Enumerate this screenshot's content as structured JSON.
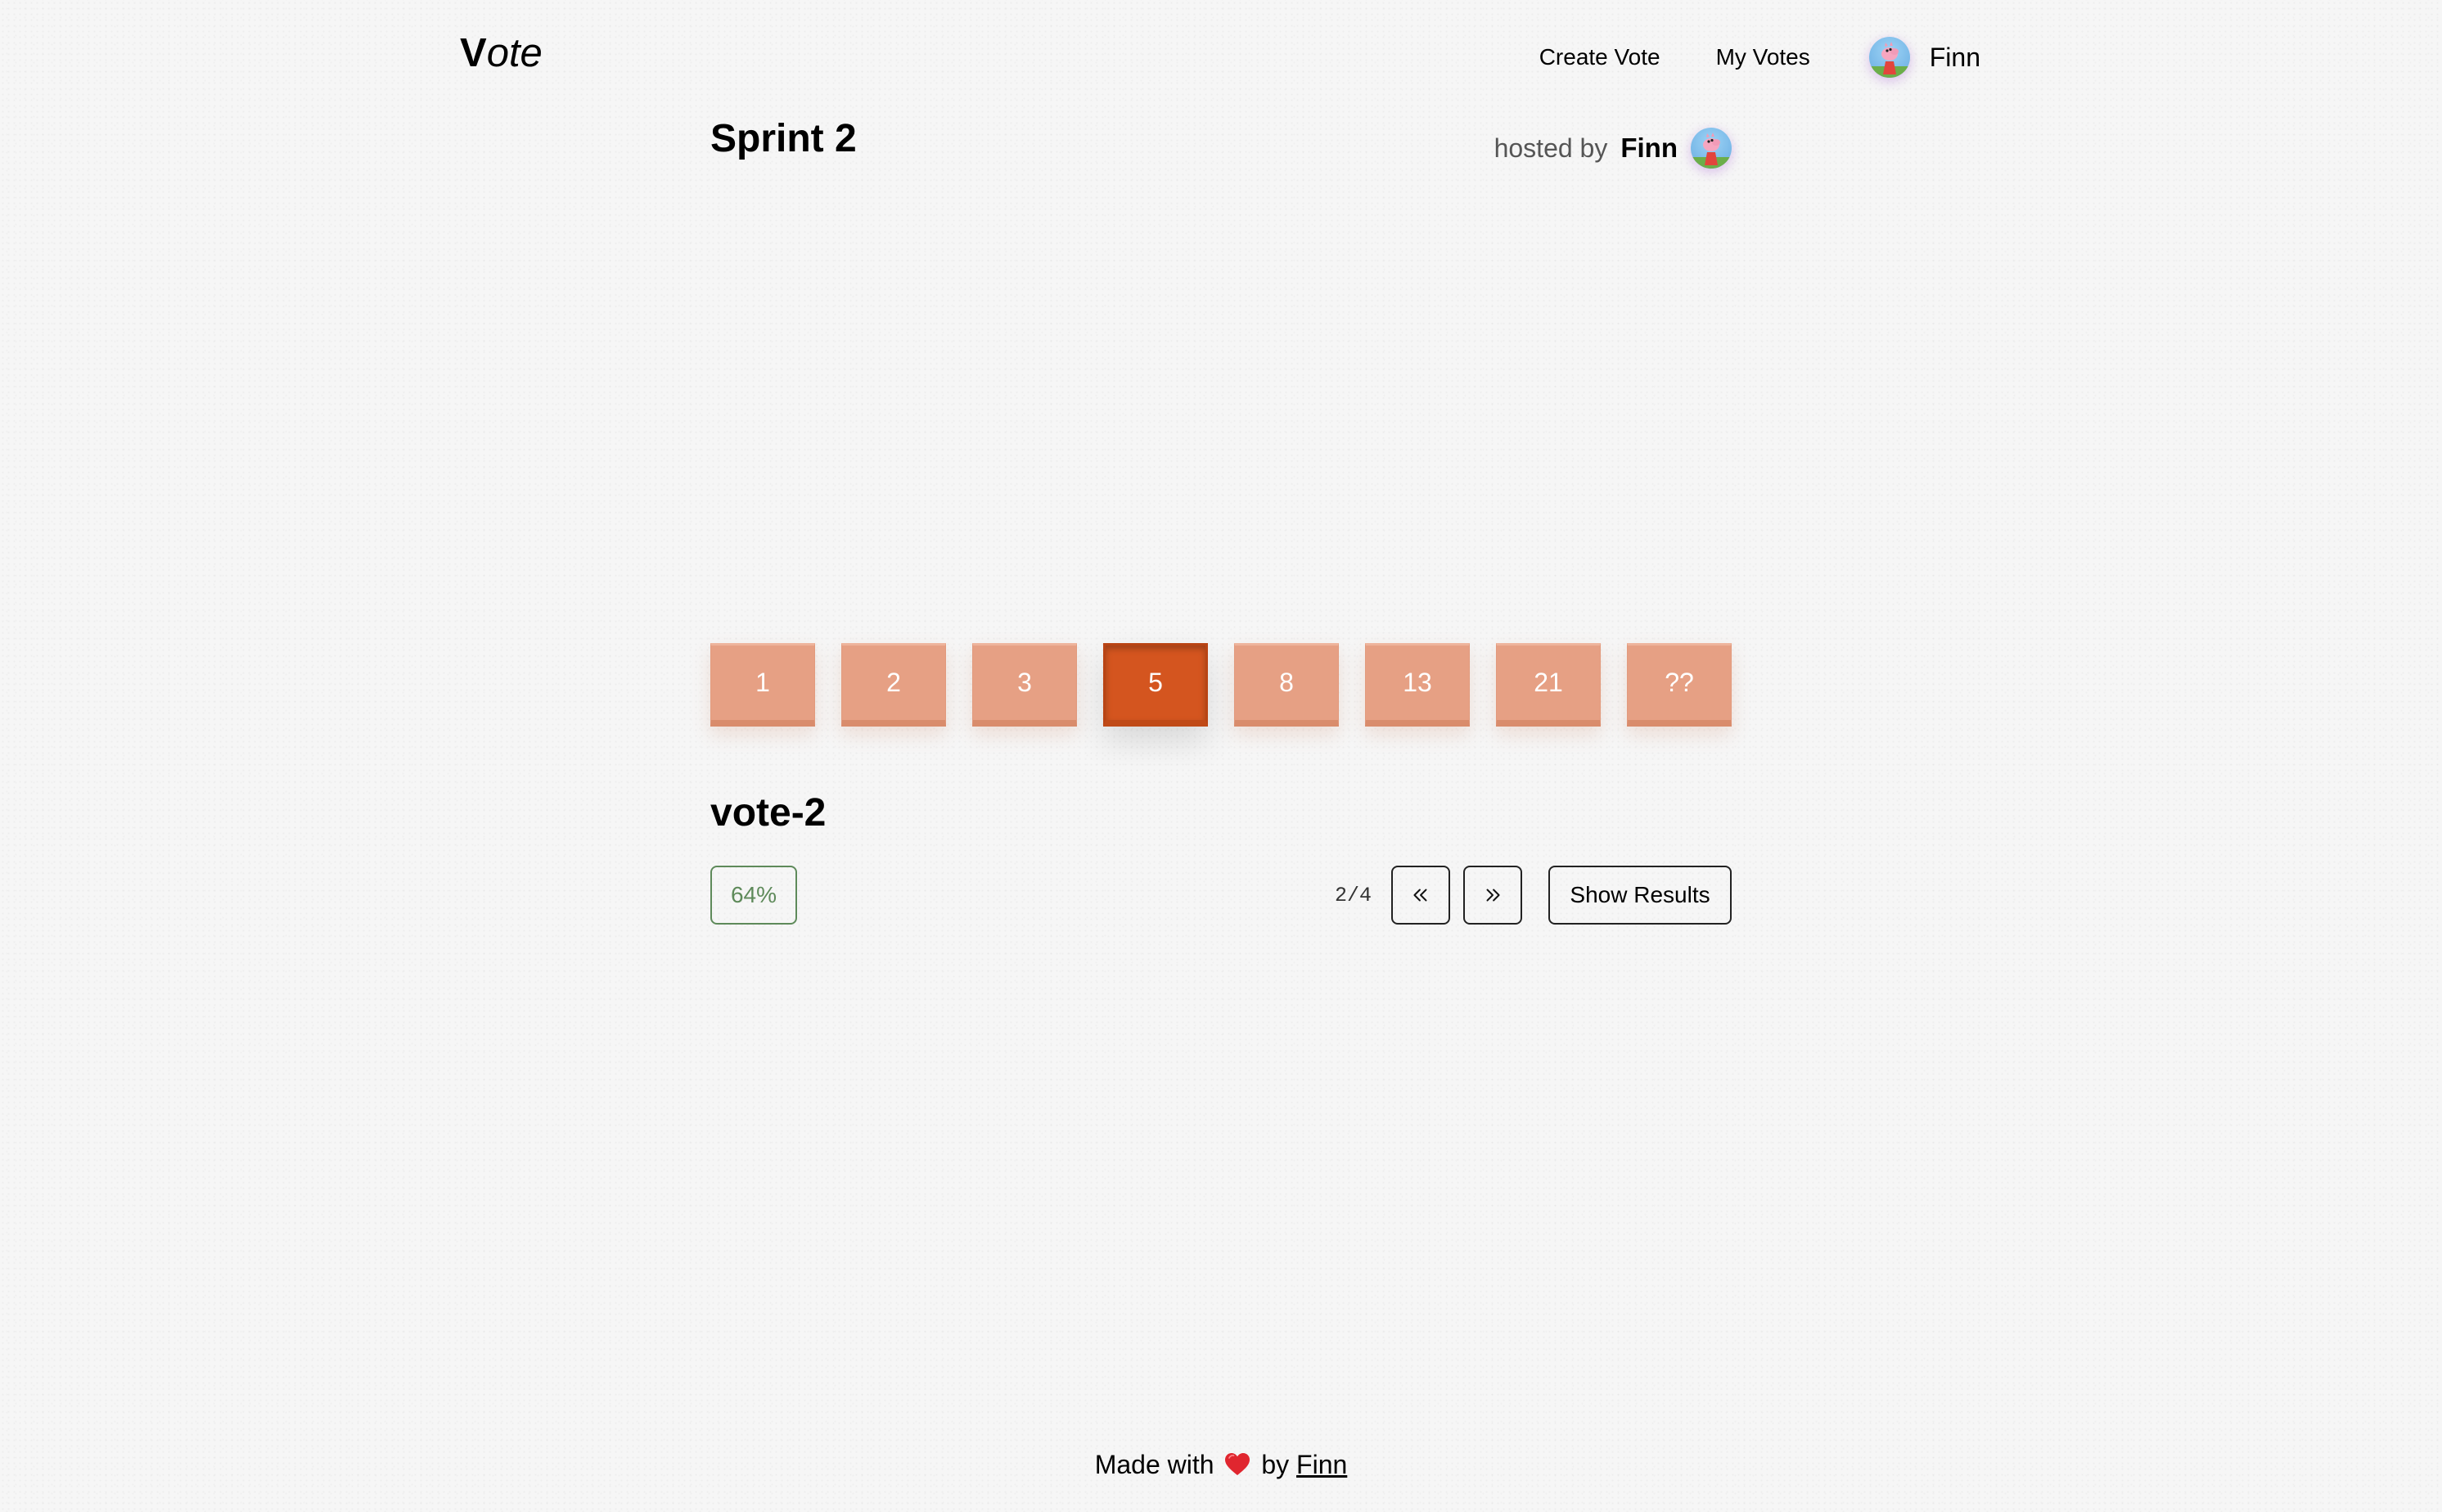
{
  "header": {
    "logo_initial": "V",
    "logo_rest": "ote",
    "nav": {
      "create_vote": "Create Vote",
      "my_votes": "My Votes",
      "user_name": "Finn"
    }
  },
  "session": {
    "title": "Sprint 2",
    "hosted_by_label": "hosted by",
    "host_name": "Finn"
  },
  "cards": [
    {
      "label": "1",
      "selected": false
    },
    {
      "label": "2",
      "selected": false
    },
    {
      "label": "3",
      "selected": false
    },
    {
      "label": "5",
      "selected": true
    },
    {
      "label": "8",
      "selected": false
    },
    {
      "label": "13",
      "selected": false
    },
    {
      "label": "21",
      "selected": false
    },
    {
      "label": "??",
      "selected": false
    }
  ],
  "vote": {
    "name": "vote-2",
    "participation": "64%",
    "page_indicator": "2/4",
    "prev_icon": "chevrons-left-icon",
    "next_icon": "chevrons-right-icon",
    "show_results_label": "Show Results"
  },
  "footer": {
    "made_with": "Made with",
    "by": "by",
    "author": "Finn",
    "heart_icon": "heart-icon"
  },
  "colors": {
    "card": "#e6a084",
    "card_selected": "#d4551f",
    "badge_green": "#5e8a5a",
    "heart": "#e0262f"
  }
}
